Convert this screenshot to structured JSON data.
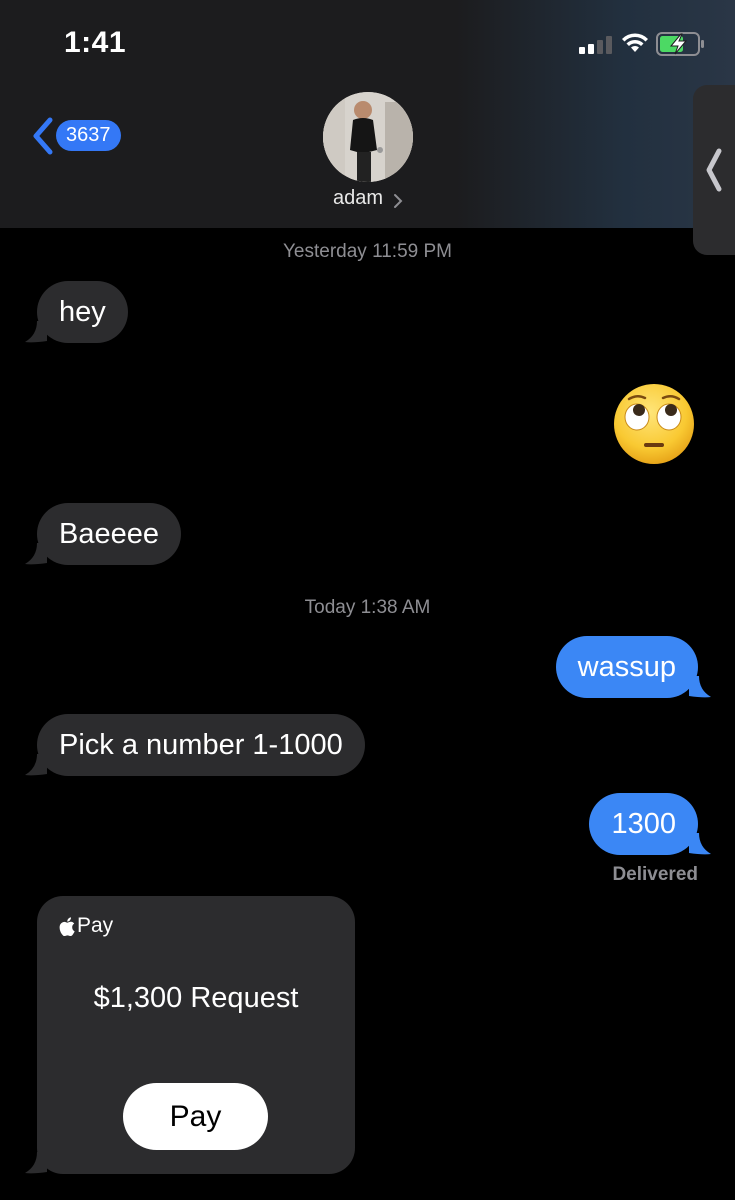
{
  "status_bar": {
    "time": "1:41",
    "signal_icon": "cellular-signal-icon",
    "wifi_icon": "wifi-icon",
    "battery_icon": "battery-charging-icon"
  },
  "header": {
    "back_count": "3637",
    "contact_name": "adam",
    "accent_color": "#3478f6"
  },
  "messages": [
    {
      "type": "timestamp",
      "text": "Yesterday 11:59 PM"
    },
    {
      "type": "incoming",
      "text": "hey"
    },
    {
      "type": "outgoing",
      "emoji": "face-with-rolling-eyes"
    },
    {
      "type": "incoming",
      "text": "Baeeee"
    },
    {
      "type": "timestamp",
      "text": "Today 1:38 AM"
    },
    {
      "type": "outgoing",
      "text": "wassup"
    },
    {
      "type": "incoming",
      "text": "Pick a number 1-1000"
    },
    {
      "type": "outgoing",
      "text": "1300",
      "status": "Delivered"
    }
  ],
  "apple_pay": {
    "brand": "Pay",
    "amount_text": "$1,300 Request",
    "button_label": "Pay"
  },
  "colors": {
    "incoming_bubble": "#2c2c2e",
    "outgoing_bubble": "#3b87f5",
    "background": "#000000"
  }
}
